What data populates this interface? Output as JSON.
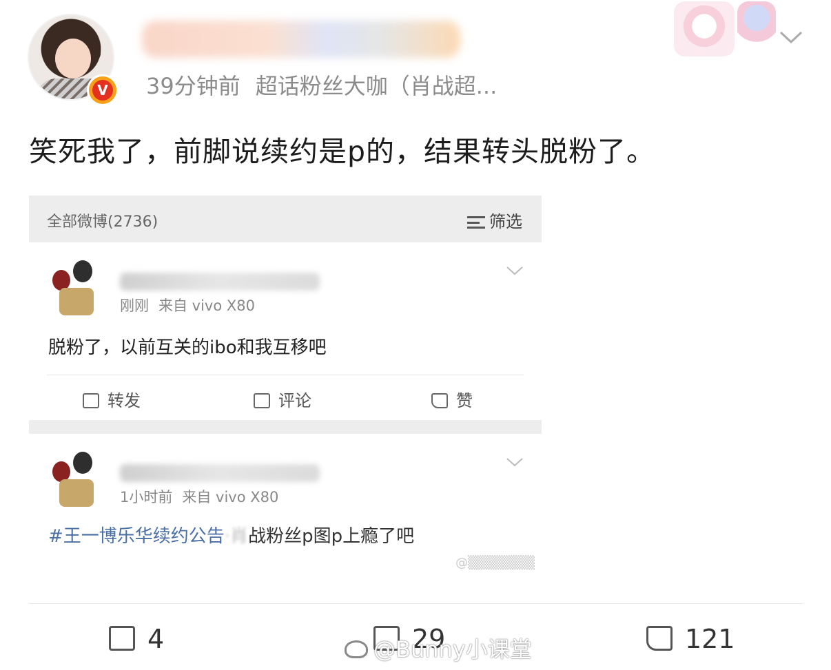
{
  "post": {
    "time": "39分钟前",
    "source": "超话粉丝大咖（肖战超...",
    "badge": "V",
    "text": "笑死我了，前脚说续约是p的，结果转头脱粉了。"
  },
  "screenshot": {
    "header_count": "全部微博(2736)",
    "filter_label": "筛选",
    "items": [
      {
        "time": "刚刚",
        "source": "来自 vivo X80",
        "text": "脱粉了，以前互关的ibo和我互移吧",
        "actions": {
          "repost": "转发",
          "comment": "评论",
          "like": "赞"
        }
      },
      {
        "time": "1小时前",
        "source": "来自 vivo X80",
        "tag": "#王一博乐华续约公告",
        "text_tail": "战粉丝p图p上瘾了吧"
      }
    ]
  },
  "footer": {
    "reposts": "4",
    "comments": "29",
    "likes": "121"
  },
  "watermark": "@Bunny小课堂",
  "icons": [
    "verified-badge",
    "chevron-down-icon",
    "filter-icon",
    "repost-icon",
    "comment-icon",
    "like-icon"
  ]
}
